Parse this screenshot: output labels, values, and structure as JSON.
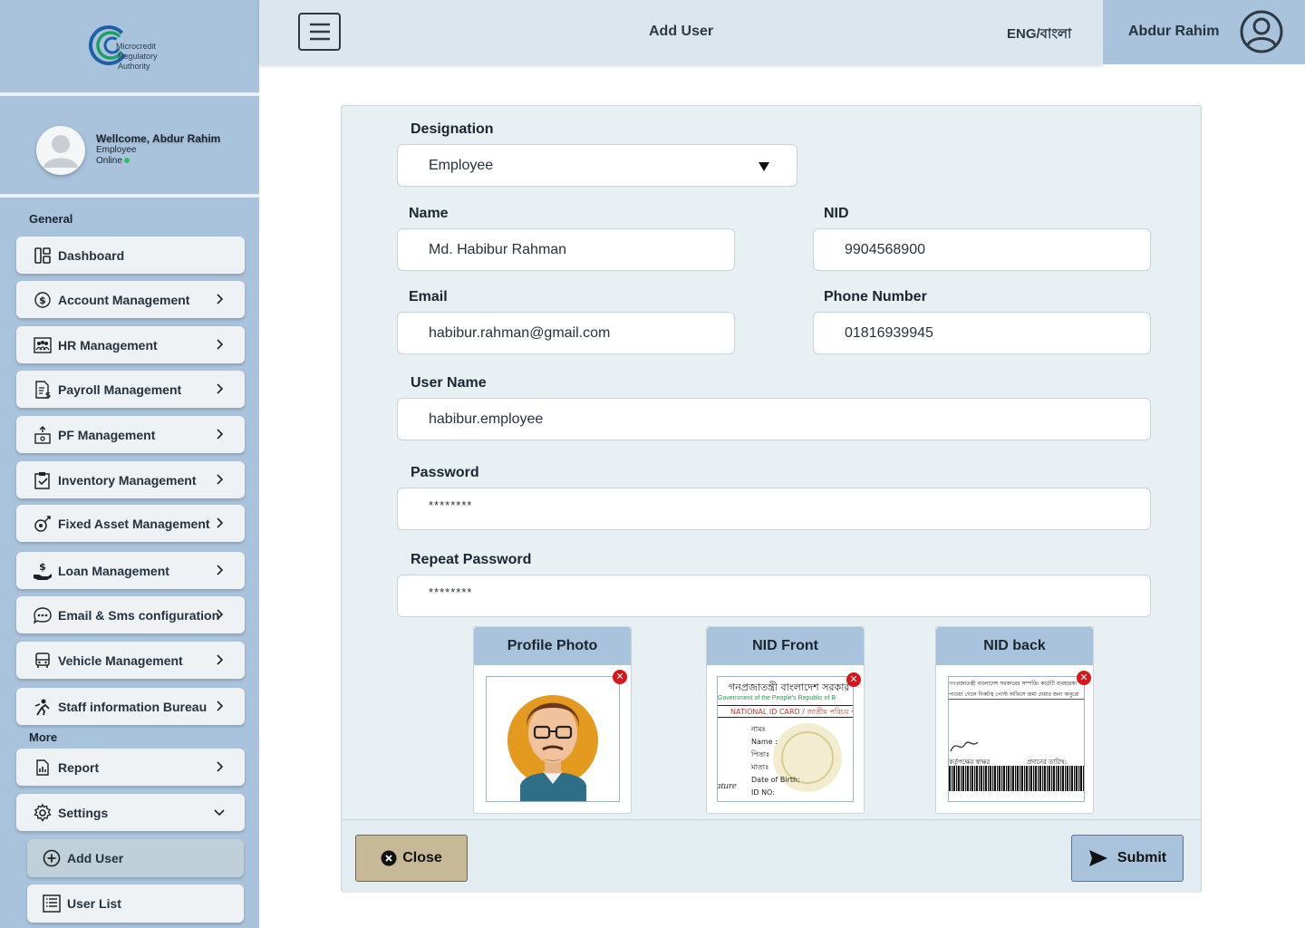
{
  "brand": {
    "line1": "Microcredit",
    "line2": "Regulatory",
    "line3": "Authority"
  },
  "profile": {
    "welcome": "Wellcome, Abdur Rahim",
    "role": "Employee",
    "status": "Online"
  },
  "sidebar": {
    "general_label": "General",
    "more_label": "More",
    "items": [
      {
        "label": "Dashboard",
        "icon": "dashboard-icon",
        "chevron": false
      },
      {
        "label": "Account Management",
        "icon": "dollar-circle-icon",
        "chevron": true
      },
      {
        "label": "HR Management",
        "icon": "team-icon",
        "chevron": true
      },
      {
        "label": "Payroll Management",
        "icon": "payroll-icon",
        "chevron": true
      },
      {
        "label": "PF Management",
        "icon": "pf-icon",
        "chevron": true
      },
      {
        "label": "Inventory Management",
        "icon": "clipboard-check-icon",
        "chevron": true
      },
      {
        "label": "Fixed Asset Management",
        "icon": "asset-icon",
        "chevron": true
      },
      {
        "label": "Loan Management",
        "icon": "loan-hand-icon",
        "chevron": true
      },
      {
        "label": "Email & Sms configuration",
        "icon": "chat-icon",
        "chevron": true
      },
      {
        "label": "Vehicle Management",
        "icon": "bus-icon",
        "chevron": true
      },
      {
        "label": "Staff information Bureau",
        "icon": "staff-icon",
        "chevron": true
      }
    ],
    "more_items": [
      {
        "label": "Report",
        "icon": "report-icon",
        "chevron": true
      },
      {
        "label": "Settings",
        "icon": "gear-icon",
        "chevron": "down"
      }
    ],
    "sub_items": [
      {
        "label": "Add User",
        "icon": "plus-circle-icon",
        "active": true
      },
      {
        "label": "User List",
        "icon": "list-icon",
        "active": false
      }
    ]
  },
  "header": {
    "title": "Add User",
    "language": "ENG/বাংলা",
    "user_name": "Abdur Rahim"
  },
  "form": {
    "designation": {
      "label": "Designation",
      "value": "Employee"
    },
    "name": {
      "label": "Name",
      "value": "Md. Habibur Rahman"
    },
    "nid": {
      "label": "NID",
      "value": "9904568900"
    },
    "email": {
      "label": "Email",
      "value": "habibur.rahman@gmail.com"
    },
    "phone": {
      "label": "Phone Number",
      "value": "01816939945"
    },
    "username": {
      "label": "User Name",
      "value": "habibur.employee"
    },
    "password": {
      "label": "Password",
      "value": "********"
    },
    "repeat_password": {
      "label": "Repeat Password",
      "value": "********"
    },
    "uploads": [
      {
        "label": "Profile Photo"
      },
      {
        "label": "NID Front"
      },
      {
        "label": "NID back"
      }
    ],
    "nid_front_text": {
      "title_bn": "গনপ্রজাতন্ত্রী বাংলাদেশ সরকার",
      "title_en": "Government of the People's Republic of B",
      "card": "NATIONAL ID CARD / জাতীয় পরিচয় প",
      "f1": "নামঃ",
      "f2": "Name :",
      "f3": "পিতাঃ",
      "f4": "মাতাঃ",
      "f5": "Date of Birth:",
      "f6": "ID NO:",
      "sig": "ature"
    },
    "nid_back_text": {
      "line1": "গণপ্রজাতন্ত্রী বাংলাদেশ সরকারের সম্পত্তি। কার্ডটি ব্যবহারকা",
      "line2": "পাওয়া গেলে নিকটস্থ পোস্ট অফিসে জমা দেয়ার জন্য অনুরো",
      "sign": "কর্তৃপক্ষের স্বাক্ষর",
      "date": "প্রদানের তারিখ:"
    },
    "close_label": "Close",
    "submit_label": "Submit"
  },
  "colors": {
    "sidebar": "#a9c3dc",
    "header": "#dbe6ee",
    "card": "#e8f0f4",
    "close": "#c7b998",
    "submit": "#a9c3dc",
    "remove": "#d7161b",
    "online": "#22c55e"
  }
}
